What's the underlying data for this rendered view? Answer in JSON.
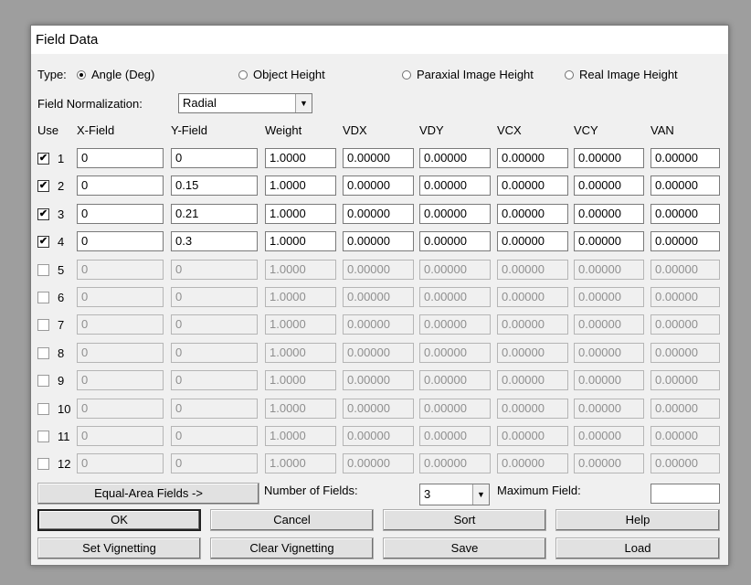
{
  "window": {
    "title": "Field Data"
  },
  "type_row": {
    "label": "Type:",
    "options": [
      {
        "label": "Angle (Deg)",
        "selected": true
      },
      {
        "label": "Object Height",
        "selected": false
      },
      {
        "label": "Paraxial Image Height",
        "selected": false
      },
      {
        "label": "Real Image Height",
        "selected": false
      }
    ]
  },
  "normalization": {
    "label": "Field Normalization:",
    "value": "Radial"
  },
  "table": {
    "headers": [
      "Use",
      "X-Field",
      "Y-Field",
      "Weight",
      "VDX",
      "VDY",
      "VCX",
      "VCY",
      "VAN"
    ],
    "rows": [
      {
        "num": "1",
        "checked": true,
        "enabled": true,
        "x": "0",
        "y": "0",
        "weight": "1.0000",
        "vdx": "0.00000",
        "vdy": "0.00000",
        "vcx": "0.00000",
        "vcy": "0.00000",
        "van": "0.00000"
      },
      {
        "num": "2",
        "checked": true,
        "enabled": true,
        "x": "0",
        "y": "0.15",
        "weight": "1.0000",
        "vdx": "0.00000",
        "vdy": "0.00000",
        "vcx": "0.00000",
        "vcy": "0.00000",
        "van": "0.00000"
      },
      {
        "num": "3",
        "checked": true,
        "enabled": true,
        "x": "0",
        "y": "0.21",
        "weight": "1.0000",
        "vdx": "0.00000",
        "vdy": "0.00000",
        "vcx": "0.00000",
        "vcy": "0.00000",
        "van": "0.00000"
      },
      {
        "num": "4",
        "checked": true,
        "enabled": true,
        "x": "0",
        "y": "0.3",
        "weight": "1.0000",
        "vdx": "0.00000",
        "vdy": "0.00000",
        "vcx": "0.00000",
        "vcy": "0.00000",
        "van": "0.00000"
      },
      {
        "num": "5",
        "checked": false,
        "enabled": false,
        "x": "0",
        "y": "0",
        "weight": "1.0000",
        "vdx": "0.00000",
        "vdy": "0.00000",
        "vcx": "0.00000",
        "vcy": "0.00000",
        "van": "0.00000"
      },
      {
        "num": "6",
        "checked": false,
        "enabled": false,
        "x": "0",
        "y": "0",
        "weight": "1.0000",
        "vdx": "0.00000",
        "vdy": "0.00000",
        "vcx": "0.00000",
        "vcy": "0.00000",
        "van": "0.00000"
      },
      {
        "num": "7",
        "checked": false,
        "enabled": false,
        "x": "0",
        "y": "0",
        "weight": "1.0000",
        "vdx": "0.00000",
        "vdy": "0.00000",
        "vcx": "0.00000",
        "vcy": "0.00000",
        "van": "0.00000"
      },
      {
        "num": "8",
        "checked": false,
        "enabled": false,
        "x": "0",
        "y": "0",
        "weight": "1.0000",
        "vdx": "0.00000",
        "vdy": "0.00000",
        "vcx": "0.00000",
        "vcy": "0.00000",
        "van": "0.00000"
      },
      {
        "num": "9",
        "checked": false,
        "enabled": false,
        "x": "0",
        "y": "0",
        "weight": "1.0000",
        "vdx": "0.00000",
        "vdy": "0.00000",
        "vcx": "0.00000",
        "vcy": "0.00000",
        "van": "0.00000"
      },
      {
        "num": "10",
        "checked": false,
        "enabled": false,
        "x": "0",
        "y": "0",
        "weight": "1.0000",
        "vdx": "0.00000",
        "vdy": "0.00000",
        "vcx": "0.00000",
        "vcy": "0.00000",
        "van": "0.00000"
      },
      {
        "num": "11",
        "checked": false,
        "enabled": false,
        "x": "0",
        "y": "0",
        "weight": "1.0000",
        "vdx": "0.00000",
        "vdy": "0.00000",
        "vcx": "0.00000",
        "vcy": "0.00000",
        "van": "0.00000"
      },
      {
        "num": "12",
        "checked": false,
        "enabled": false,
        "x": "0",
        "y": "0",
        "weight": "1.0000",
        "vdx": "0.00000",
        "vdy": "0.00000",
        "vcx": "0.00000",
        "vcy": "0.00000",
        "van": "0.00000"
      }
    ]
  },
  "bottom": {
    "equal_area_label": "Equal-Area Fields ->",
    "num_fields_label": "Number of Fields:",
    "num_fields_value": "3",
    "max_field_label": "Maximum Field:",
    "max_field_value": ""
  },
  "buttons": {
    "ok": "OK",
    "cancel": "Cancel",
    "sort": "Sort",
    "help": "Help",
    "set_vignetting": "Set Vignetting",
    "clear_vignetting": "Clear Vignetting",
    "save": "Save",
    "load": "Load"
  },
  "checkmark_glyph": "✔",
  "dropdown_arrow_glyph": "▼"
}
